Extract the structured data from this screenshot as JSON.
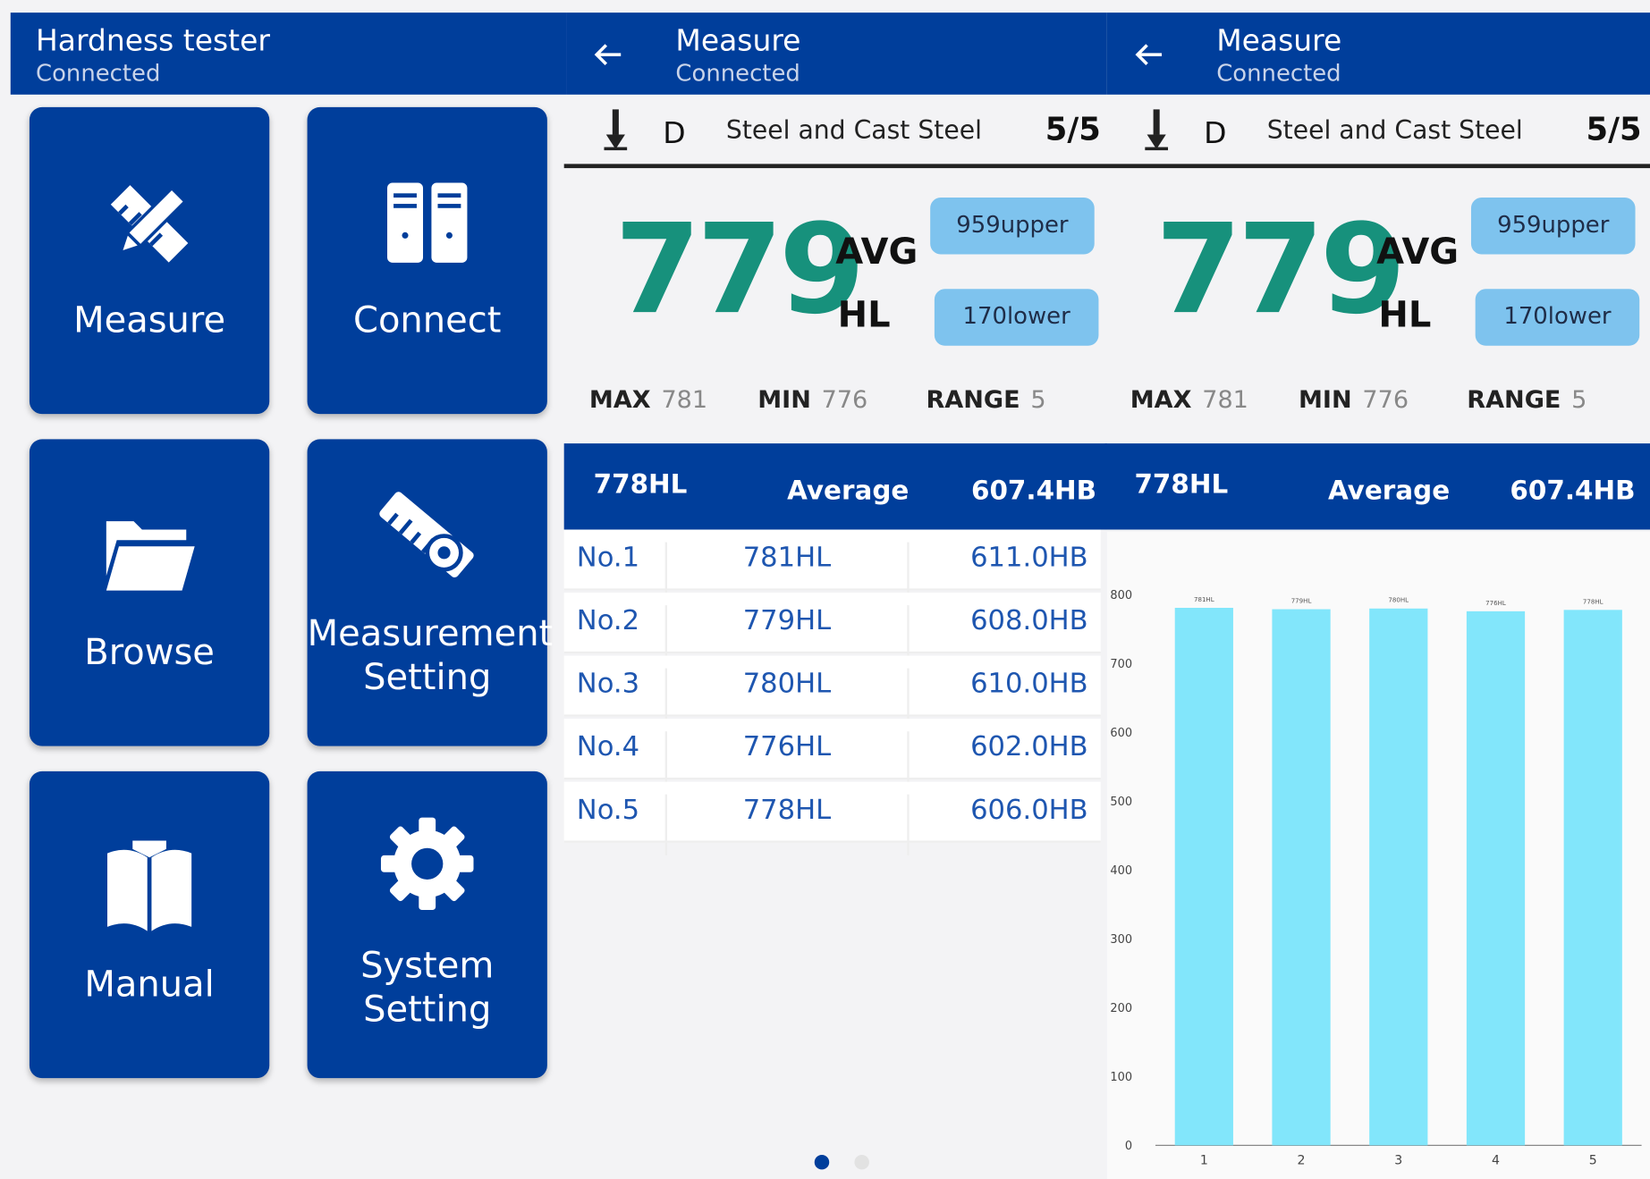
{
  "home": {
    "title": "Hardness tester",
    "status": "Connected",
    "tiles": [
      {
        "label": "Measure",
        "icon": "pencil-ruler-icon"
      },
      {
        "label": "Connect",
        "icon": "device-pair-icon"
      },
      {
        "label": "Browse",
        "icon": "folder-icon"
      },
      {
        "label": "Measurement Setting",
        "label_line1": "Measurement",
        "label_line2": "Setting",
        "icon": "ruler-gear-icon"
      },
      {
        "label": "Manual",
        "icon": "book-icon"
      },
      {
        "label": "System Setting",
        "label_line1": "System",
        "label_line2": "Setting",
        "icon": "gear-icon"
      }
    ]
  },
  "measure": {
    "title": "Measure",
    "status": "Connected",
    "probe": "D",
    "material": "Steel and Cast Steel",
    "count": "5/5",
    "value": "779",
    "avg_label": "AVG",
    "unit": "HL",
    "upper": "959upper",
    "lower": "170lower",
    "max_label": "MAX",
    "max": "781",
    "min_label": "MIN",
    "min": "776",
    "range_label": "RANGE",
    "range": "5",
    "summary": {
      "hl": "778HL",
      "label": "Average",
      "hb": "607.4HB"
    },
    "rows": [
      {
        "no": "No.1",
        "hl": "781HL",
        "hb": "611.0HB"
      },
      {
        "no": "No.2",
        "hl": "779HL",
        "hb": "608.0HB"
      },
      {
        "no": "No.3",
        "hl": "780HL",
        "hb": "610.0HB"
      },
      {
        "no": "No.4",
        "hl": "776HL",
        "hb": "602.0HB"
      },
      {
        "no": "No.5",
        "hl": "778HL",
        "hb": "606.0HB"
      }
    ]
  },
  "colors": {
    "primary": "#003e9b",
    "value_green": "#17917c",
    "pill": "#7ec3ee",
    "bar": "#82e6fb"
  },
  "chart_data": {
    "type": "bar",
    "categories": [
      "1",
      "2",
      "3",
      "4",
      "5"
    ],
    "values": [
      781,
      779,
      780,
      776,
      778
    ],
    "ylim": [
      0,
      800
    ],
    "yticks": [
      0,
      100,
      200,
      300,
      400,
      500,
      600,
      700,
      800
    ],
    "grid": false
  }
}
